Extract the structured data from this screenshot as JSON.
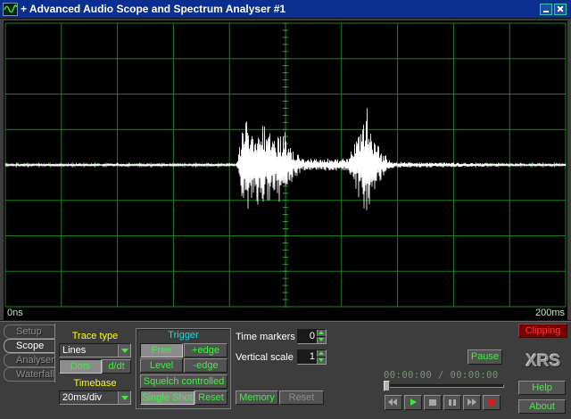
{
  "window": {
    "title": "+ Advanced Audio Scope and Spectrum Analyser #1",
    "app_icon": "scope-wave-icon",
    "controls": [
      "minimize-icon",
      "close-icon"
    ]
  },
  "colors": {
    "title_bar": "#0b2f90",
    "scope_bg": "#000000",
    "grid": "#1f7f1f",
    "axis_ticks": "#34a834",
    "trace": "#ffffff",
    "panel_bg": "#3d3d3d",
    "button_text": "#3cf03c",
    "label_yellow": "#ffff00",
    "label_cyan": "#00e6e6",
    "clipping": "#ff3a3a"
  },
  "scope": {
    "time_start": "0ns",
    "time_end": "200ms",
    "grid": true
  },
  "tabs": [
    {
      "label": "Setup",
      "selected": false
    },
    {
      "label": "Scope",
      "selected": true
    },
    {
      "label": "Analyser",
      "selected": false
    },
    {
      "label": "Waterfall",
      "selected": false
    }
  ],
  "trace_type": {
    "label": "Trace type",
    "value": "Lines",
    "dots_label": "Dots",
    "ddt_label": "d/dt",
    "dots_active": true,
    "ddt_active": false
  },
  "timebase": {
    "label": "Timebase",
    "value": "20ms/div"
  },
  "trigger": {
    "label": "Trigger",
    "free": "Free",
    "plus_edge": "+edge",
    "level": "Level",
    "minus_edge": "-edge",
    "squelch": "Squelch controlled",
    "single_shot": "Single Shot",
    "reset": "Reset",
    "free_active": true,
    "plus_edge_active": false,
    "level_active": false,
    "minus_edge_active": false,
    "squelch_active": false,
    "single_shot_active": true
  },
  "markers": {
    "time_markers_label": "Time markers",
    "time_markers_value": "0",
    "vertical_scale_label": "Vertical scale",
    "vertical_scale_value": "1"
  },
  "memory": {
    "memory_label": "Memory",
    "reset_label": "Reset",
    "reset_enabled": false
  },
  "playback": {
    "pause_label": "Pause",
    "time_display": "00:00:00 / 00:00:00",
    "position": 0,
    "transport": [
      "rewind-icon",
      "play-icon",
      "stop-icon",
      "pause-icon",
      "fast-forward-icon",
      "record-icon"
    ]
  },
  "side": {
    "logo": "XRS",
    "clipping_label": "Clipping",
    "help_label": "Help",
    "about_label": "About"
  }
}
